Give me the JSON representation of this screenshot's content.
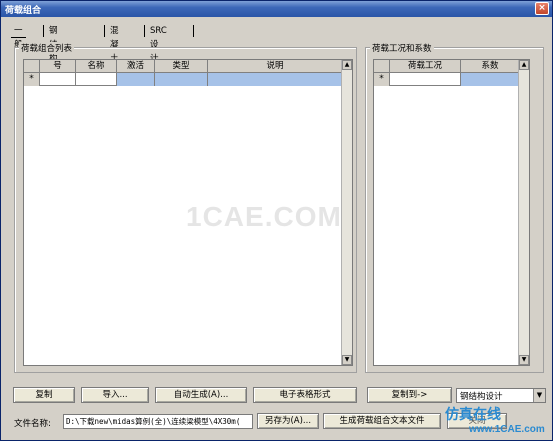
{
  "window": {
    "title": "荷载组合",
    "close_label": "×"
  },
  "tabs": [
    "一般",
    "钢结构设计",
    "混凝土设计",
    "SRC设计"
  ],
  "left_group": {
    "label": "荷载组合列表",
    "columns": [
      "号",
      "名称",
      "激活",
      "类型",
      "说明"
    ],
    "new_row_marker": "*"
  },
  "right_group": {
    "label": "荷载工况和系数",
    "columns": [
      "荷载工况",
      "系数"
    ],
    "new_row_marker": "*"
  },
  "buttons": {
    "copy": "复制",
    "import": "导入...",
    "auto_gen": "自动生成(A)...",
    "spreadsheet": "电子表格形式",
    "copy_to": "复制到->",
    "save_as": "另存为(A)...",
    "gen_text": "生成荷载组合文本文件"
  },
  "copy_to_combo": {
    "value": "钢结构设计"
  },
  "file": {
    "label": "文件名称:",
    "path": "D:\\下载new\\midas算例(全)\\连续梁模型\\4X30m(",
    "close_partial": "关闭"
  },
  "watermarks": {
    "center": "1CAE.COM",
    "brand_cn": "仿真在线",
    "brand_url": "www.1CAE.com"
  }
}
